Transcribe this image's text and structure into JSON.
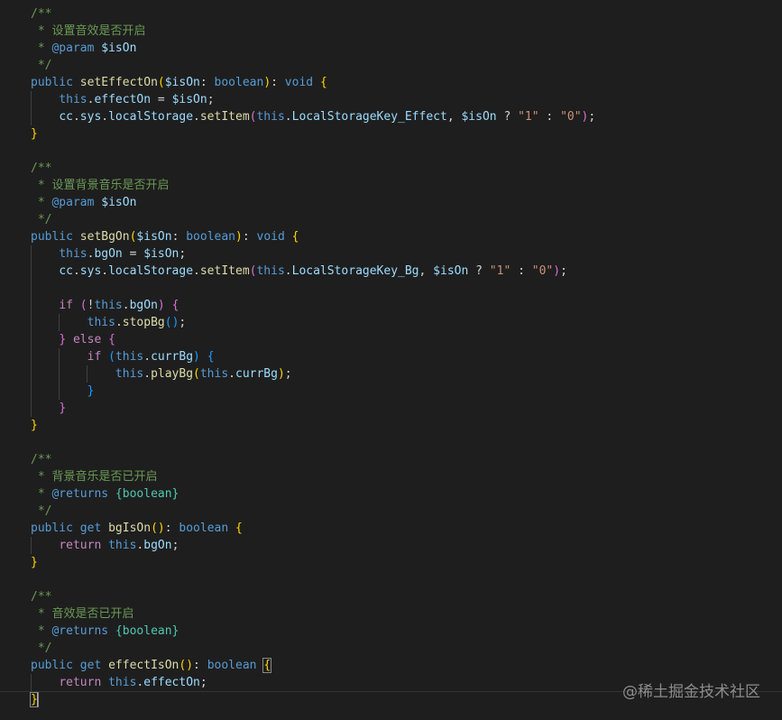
{
  "code": {
    "lines": [
      "/**",
      " * 设置音效是否开启",
      " * @param $isOn",
      " */",
      "public setEffectOn($isOn: boolean): void {",
      "    this.effectOn = $isOn;",
      "    cc.sys.localStorage.setItem(this.LocalStorageKey_Effect, $isOn ? \"1\" : \"0\");",
      "}",
      "",
      "/**",
      " * 设置背景音乐是否开启",
      " * @param $isOn",
      " */",
      "public setBgOn($isOn: boolean): void {",
      "    this.bgOn = $isOn;",
      "    cc.sys.localStorage.setItem(this.LocalStorageKey_Bg, $isOn ? \"1\" : \"0\");",
      "",
      "    if (!this.bgOn) {",
      "        this.stopBg();",
      "    } else {",
      "        if (this.currBg) {",
      "            this.playBg(this.currBg);",
      "        }",
      "    }",
      "}",
      "",
      "/**",
      " * 背景音乐是否已开启",
      " * @returns {boolean}",
      " */",
      "public get bgIsOn(): boolean {",
      "    return this.bgOn;",
      "}",
      "",
      "/**",
      " * 音效是否已开启",
      " * @returns {boolean}",
      " */",
      "public get effectIsOn(): boolean {",
      "    return this.effectOn;",
      "}"
    ]
  },
  "watermark": "@稀土掘金技术社区",
  "colors": {
    "background": "#1e1e1e",
    "comment": "#6a9955",
    "keyword": "#569cd6",
    "control": "#c586c0",
    "function": "#dcdcaa",
    "variable": "#9cdcfe",
    "type": "#4ec9b0",
    "string": "#ce9178"
  }
}
